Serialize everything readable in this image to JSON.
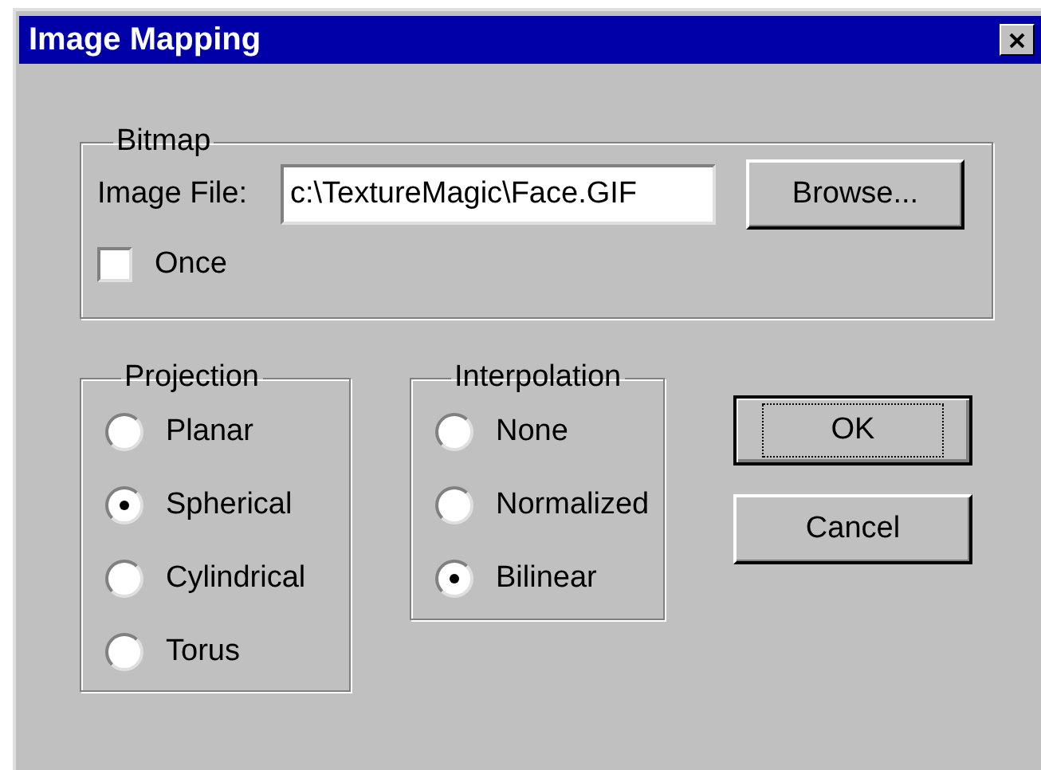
{
  "window": {
    "title": "Image Mapping"
  },
  "bitmap": {
    "label": "Bitmap",
    "image_file": {
      "label": "Image File:",
      "value": "c:\\TextureMagic\\Face.GIF"
    },
    "browse_button": "Browse...",
    "once": {
      "label": "Once",
      "checked": false
    }
  },
  "projection": {
    "label": "Projection",
    "options": [
      {
        "label": "Planar",
        "selected": false
      },
      {
        "label": "Spherical",
        "selected": true
      },
      {
        "label": "Cylindrical",
        "selected": false
      },
      {
        "label": "Torus",
        "selected": false
      }
    ]
  },
  "interpolation": {
    "label": "Interpolation",
    "options": [
      {
        "label": "None",
        "selected": false
      },
      {
        "label": "Normalized",
        "selected": false
      },
      {
        "label": "Bilinear",
        "selected": true
      }
    ]
  },
  "buttons": [
    {
      "label": "OK",
      "default": true
    },
    {
      "label": "Cancel",
      "default": false
    }
  ]
}
